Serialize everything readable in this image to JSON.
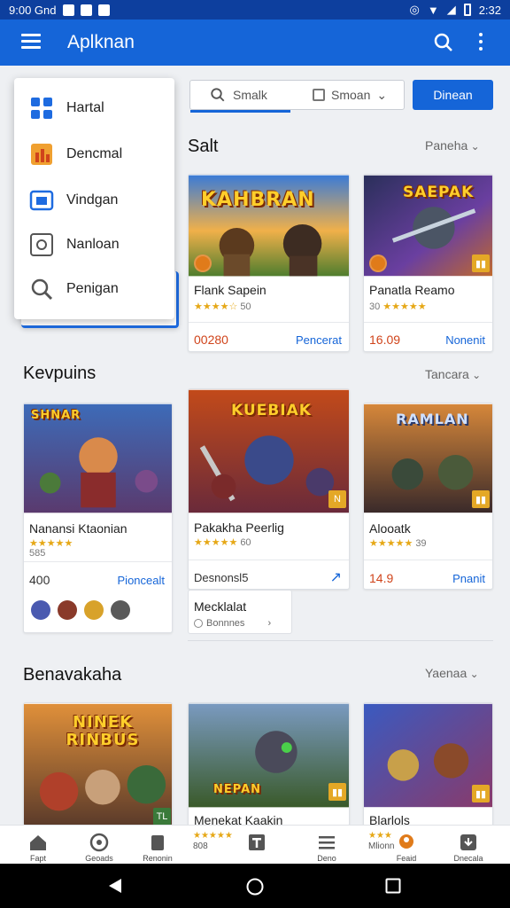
{
  "status_bar": {
    "time_left": "9:00 Gnd",
    "time_right": "2:32"
  },
  "app_bar": {
    "title": "Aplknan"
  },
  "search": {
    "query": "Smalk",
    "select_label": "Smoan"
  },
  "primary_button": {
    "label": "Dinean"
  },
  "drawer": {
    "items": [
      {
        "label": "Hartal",
        "icon": "grid-icon"
      },
      {
        "label": "Dencmal",
        "icon": "chart-icon"
      },
      {
        "label": "Vindgan",
        "icon": "window-icon"
      },
      {
        "label": "Nanloan",
        "icon": "settings-icon"
      },
      {
        "label": "Penigan",
        "icon": "search-icon"
      }
    ]
  },
  "sections": [
    {
      "title": "Salt",
      "more": "Paneha",
      "cards": [
        {
          "name": "Flank Sapein",
          "rating": "★★★★☆",
          "count": "50",
          "price": "00280",
          "action": "Pencerat",
          "banner": "KAHBRAN"
        },
        {
          "name": "Panatla Reamo",
          "rating": "★★★★★",
          "count": "30",
          "price": "16.09",
          "action": "Nonenit",
          "banner": "SAEPAK"
        }
      ]
    },
    {
      "title": "Kevpuins",
      "more": "Tancara",
      "cards": [
        {
          "name": "Nanansi Ktaonian",
          "rating": "★★★★★",
          "count": "585",
          "price": "400",
          "action": "Pioncealt",
          "banner": "SHNAR"
        },
        {
          "name": "Pakakha Peerlig",
          "rating": "★★★★★",
          "count": "60",
          "price": "Desnonsl5",
          "action": "",
          "banner": "KUEBIAK"
        },
        {
          "name": "Alooatk",
          "rating": "★★★★★",
          "count": "39",
          "price": "14.9",
          "action": "Pnanit",
          "banner": "RAMLAN"
        }
      ],
      "mini_card": {
        "title": "Mecklalat",
        "subtitle": "Bonnnes"
      }
    },
    {
      "title": "Benavakaha",
      "more": "Yaenaa",
      "cards": [
        {
          "name": "",
          "banner": "NINEK RINBUS"
        },
        {
          "name": "Menekat Kaakin",
          "rating": "★★★★★",
          "count": "808",
          "banner": "NEPAN"
        },
        {
          "name": "Blarlols",
          "rating": "★★★",
          "count": "Mlionn",
          "banner": ""
        }
      ]
    }
  ],
  "bottom_nav": [
    {
      "label": "Fapt",
      "icon": "home-icon"
    },
    {
      "label": "Geoads",
      "icon": "compass-icon"
    },
    {
      "label": "Renonin",
      "icon": "book-icon"
    },
    {
      "label": "",
      "icon": "text-icon"
    },
    {
      "label": "Deno",
      "icon": "menu-icon"
    },
    {
      "label": "Feaid",
      "icon": "person-icon"
    },
    {
      "label": "Dnecala",
      "icon": "download-icon"
    }
  ],
  "colors": {
    "primary": "#1565d8",
    "status_bar": "#0d3f9e",
    "price": "#d0441b",
    "star": "#e6a817"
  }
}
